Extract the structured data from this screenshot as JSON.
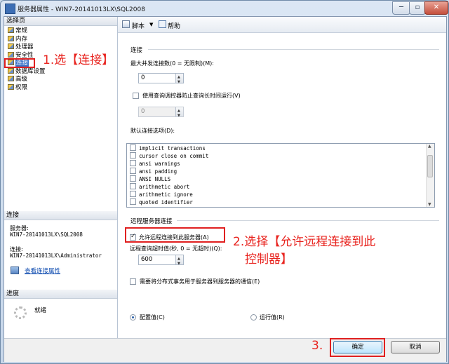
{
  "window": {
    "title": "服务器属性 - WIN7-20141013LX\\SQL2008",
    "min": "─",
    "max": "▫",
    "close": "✕"
  },
  "left": {
    "select_page_header": "选择页",
    "nav_items": [
      "常规",
      "内存",
      "处理器",
      "安全性",
      "连接",
      "数据库设置",
      "高级",
      "权限"
    ],
    "selected_index": 4,
    "connection_header": "连接",
    "server_label": "服务器:",
    "server_value": "WIN7-20141013LX\\SQL2008",
    "conn_label": "连接:",
    "conn_value": "WIN7-20141013LX\\Administrator",
    "view_conn_link": "查看连接属性",
    "progress_header": "进度",
    "progress_status": "就绪"
  },
  "toolbar": {
    "script": "脚本",
    "help": "帮助"
  },
  "main": {
    "connections_group": "连接",
    "max_conn_label": "最大并发连接数(0 = 无限制)(M):",
    "max_conn_value": "0",
    "query_governor_label": "使用查询调控器防止查询长时间运行(V)",
    "query_governor_checked": false,
    "query_governor_value": "0",
    "default_options_label": "默认连接选项(D):",
    "options": [
      "implicit transactions",
      "cursor close on commit",
      "ansi warnings",
      "ansi padding",
      "ANSI NULLS",
      "arithmetic abort",
      "arithmetic ignore",
      "quoted identifier"
    ],
    "remote_group": "远程服务器连接",
    "allow_remote_label": "允许远程连接到此服务器(A)",
    "allow_remote_checked": true,
    "remote_timeout_label": "远程查询超时值(秒, 0 = 无超时)(Q):",
    "remote_timeout_value": "600",
    "distributed_label": "需要将分布式事务用于服务器到服务器的通信(E)",
    "distributed_checked": false,
    "configured_label": "配置值(C)",
    "running_label": "运行值(R)",
    "selected_radio": "configured"
  },
  "buttons": {
    "ok": "确定",
    "cancel": "取消"
  },
  "annotations": {
    "step1": "1.选【连接】",
    "step2_line1": "2.选择【允许远程连接到此",
    "step2_line2": "控制器】",
    "step3": "3."
  },
  "colors": {
    "annotation": "#e8231e",
    "selection": "#3a72c8"
  }
}
